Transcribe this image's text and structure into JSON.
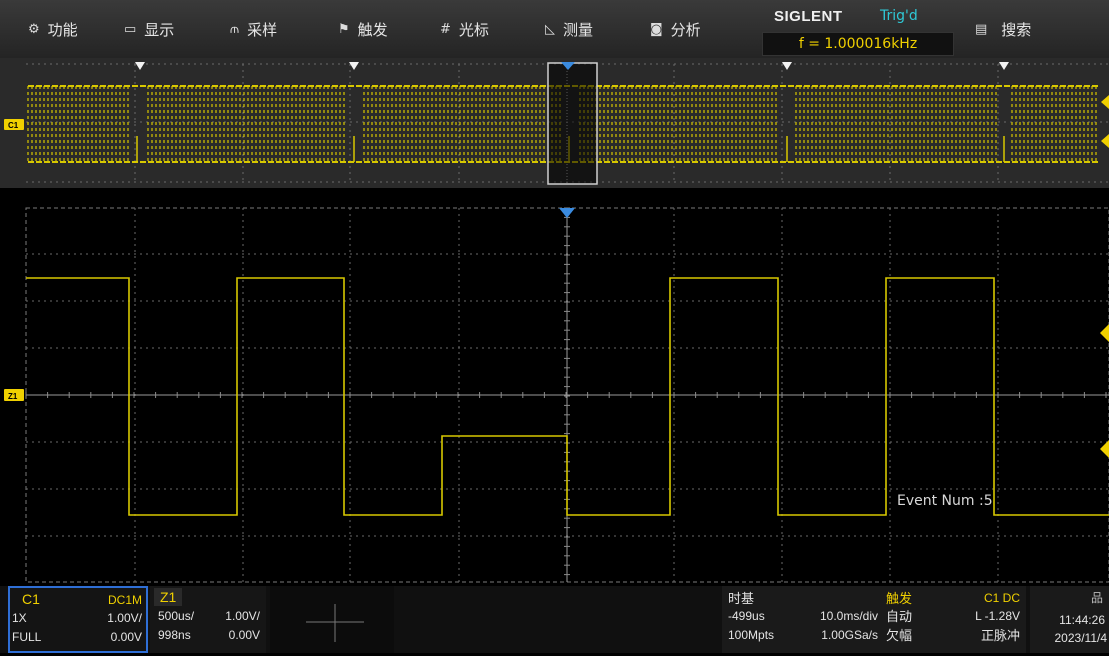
{
  "menu": [
    {
      "label": "功能",
      "icon": "gear-icon",
      "glyph": "⚙"
    },
    {
      "label": "显示",
      "icon": "display-icon",
      "glyph": "▭"
    },
    {
      "label": "采样",
      "icon": "acquire-icon",
      "glyph": "⫙"
    },
    {
      "label": "触发",
      "icon": "trigger-flag-icon",
      "glyph": "⚑"
    },
    {
      "label": "光标",
      "icon": "cursor-icon",
      "glyph": "#"
    },
    {
      "label": "测量",
      "icon": "measure-icon",
      "glyph": "◺"
    },
    {
      "label": "分析",
      "icon": "analysis-icon",
      "glyph": "◙"
    },
    {
      "label": "搜索",
      "icon": "search-list-icon",
      "glyph": "▤"
    }
  ],
  "brand": {
    "logo": "SIGLENT",
    "status": "Trig'd",
    "frequency": "f = 1.000016kHz"
  },
  "markers": {
    "c1": "C1",
    "z1": "Z1"
  },
  "event_num": "Event Num :5",
  "channel1": {
    "name": "C1",
    "coupling": "DC1M",
    "probe": "1X",
    "volts_div": "1.00V/",
    "bandwidth": "FULL",
    "offset": "0.00V"
  },
  "zoom": {
    "name": "Z1",
    "time_div": "500us/",
    "volts_div": "1.00V/",
    "delay": "998ns",
    "offset": "0.00V"
  },
  "timebase": {
    "title": "时基",
    "delay": "-499us",
    "time_div": "10.0ms/div",
    "memory": "100Mpts",
    "sample_rate": "1.00GSa/s"
  },
  "trigger": {
    "title": "触发",
    "source": "C1 DC",
    "mode": "自动",
    "level": "L -1.28V",
    "type": "欠幅",
    "polarity": "正脉冲"
  },
  "clock": {
    "time": "11:44:26",
    "date": "2023/11/4"
  },
  "colors": {
    "trace": "#d7c800",
    "accent": "#2f6fd6",
    "trig_status": "#2fc9d6"
  }
}
